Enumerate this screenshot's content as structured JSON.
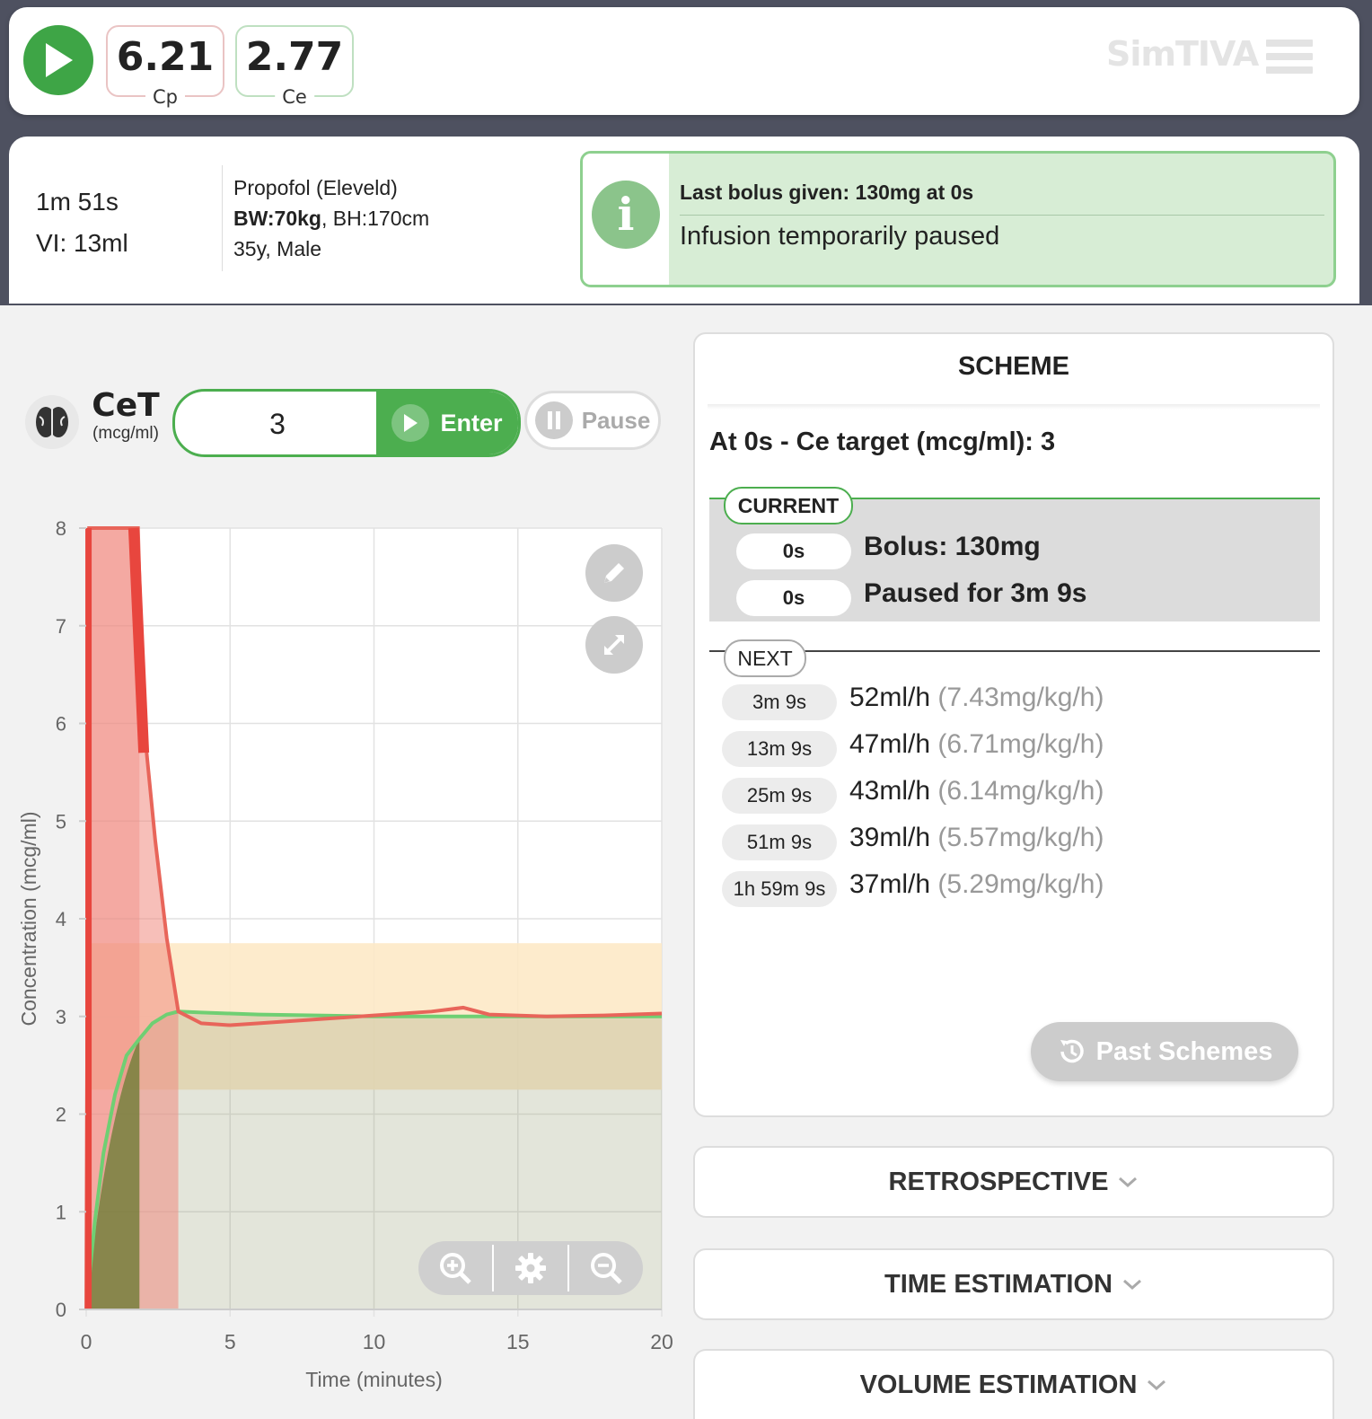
{
  "header": {
    "play_icon": "play-icon",
    "cp": {
      "value": "6.21",
      "label": "Cp"
    },
    "ce": {
      "value": "2.77",
      "label": "Ce"
    },
    "logo": "SimTIVA",
    "menu_icon": "hamburger-menu-icon"
  },
  "info": {
    "elapsed": "1m 51s",
    "volume": "VI: 13ml",
    "drug": "Propofol (Eleveld)",
    "bw": "BW:70kg",
    "bh": ", BH:170cm",
    "demographics": "35y, Male"
  },
  "alert": {
    "icon": "info-icon",
    "title": "Last bolus given: 130mg at 0s",
    "message": "Infusion temporarily paused"
  },
  "controls": {
    "target_label": "CeT",
    "target_unit": "(mcg/ml)",
    "target_value": "3",
    "enter_label": "Enter",
    "pause_label": "Pause"
  },
  "scheme": {
    "title": "SCHEME",
    "target_line": "At 0s - Ce target (mcg/ml): 3",
    "current_label": "CURRENT",
    "current": [
      {
        "time": "0s",
        "desc": "Bolus: 130mg"
      },
      {
        "time": "0s",
        "desc": "Paused for 3m 9s"
      }
    ],
    "next_label": "NEXT",
    "next": [
      {
        "time": "3m 9s",
        "rate": "52ml/h",
        "dose": "(7.43mg/kg/h)"
      },
      {
        "time": "13m 9s",
        "rate": "47ml/h",
        "dose": "(6.71mg/kg/h)"
      },
      {
        "time": "25m 9s",
        "rate": "43ml/h",
        "dose": "(6.14mg/kg/h)"
      },
      {
        "time": "51m 9s",
        "rate": "39ml/h",
        "dose": "(5.57mg/kg/h)"
      },
      {
        "time": "1h 59m 9s",
        "rate": "37ml/h",
        "dose": "(5.29mg/kg/h)"
      }
    ],
    "past_label": "Past Schemes"
  },
  "sections": {
    "retrospective": "RETROSPECTIVE",
    "time_estimation": "TIME ESTIMATION",
    "volume_estimation": "VOLUME ESTIMATION"
  },
  "colors": {
    "green": "#4cae4f",
    "cp_line": "#e8655a",
    "ce_line": "#6fcf73",
    "target_band": "#fde9c6"
  },
  "chart_data": {
    "type": "line",
    "xlabel": "Time (minutes)",
    "ylabel": "Concentration (mcg/ml)",
    "xlim": [
      0,
      20
    ],
    "ylim": [
      0,
      8
    ],
    "x_ticks": [
      "0",
      "5",
      "10",
      "15",
      "20"
    ],
    "y_ticks": [
      "0",
      "1",
      "2",
      "3",
      "4",
      "5",
      "6",
      "7",
      "8"
    ],
    "target_band": [
      2.25,
      3.75
    ],
    "series": [
      {
        "color": "#e8655a",
        "x": [
          0,
          0.1,
          0.2,
          1.8,
          2.0,
          2.4,
          2.8,
          3.2,
          4,
          5,
          6,
          8,
          10,
          12,
          13.1,
          14,
          16,
          18,
          20
        ],
        "y": [
          0,
          8,
          8,
          8,
          6.0,
          4.8,
          3.8,
          3.05,
          2.93,
          2.91,
          2.93,
          2.97,
          3.01,
          3.05,
          3.09,
          3.02,
          3.0,
          3.01,
          3.03
        ]
      },
      {
        "color": "#6fcf73",
        "x": [
          0,
          0.3,
          0.6,
          1.0,
          1.4,
          1.85,
          2.3,
          2.8,
          3.2,
          4,
          5,
          6,
          8,
          10,
          12,
          14,
          16,
          18,
          20
        ],
        "y": [
          0,
          0.9,
          1.6,
          2.2,
          2.6,
          2.77,
          2.93,
          3.02,
          3.05,
          3.04,
          3.03,
          3.02,
          3.01,
          3.0,
          3.0,
          3.0,
          3.0,
          3.0,
          3.0
        ]
      }
    ]
  }
}
